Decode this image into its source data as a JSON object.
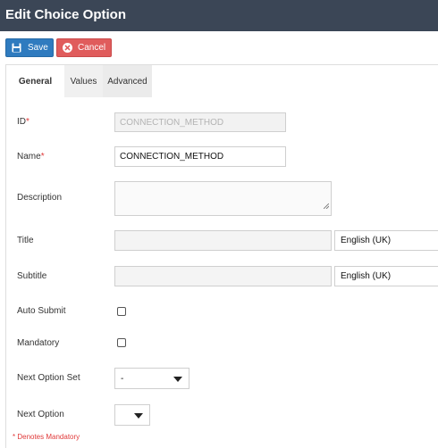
{
  "window": {
    "title": "Edit Choice Option"
  },
  "toolbar": {
    "save_label": "Save",
    "cancel_label": "Cancel"
  },
  "tabs": [
    {
      "label": "General",
      "active": true
    },
    {
      "label": "Values",
      "active": false
    },
    {
      "label": "Advanced",
      "active": false
    }
  ],
  "form": {
    "id": {
      "label": "ID",
      "required_mark": "*",
      "value": "CONNECTION_METHOD",
      "disabled": true
    },
    "name": {
      "label": "Name",
      "required_mark": "*",
      "value": "CONNECTION_METHOD"
    },
    "description": {
      "label": "Description",
      "value": ""
    },
    "title": {
      "label": "Title",
      "value": "",
      "language": "English (UK)"
    },
    "subtitle": {
      "label": "Subtitle",
      "value": "",
      "language": "English (UK)"
    },
    "auto_submit": {
      "label": "Auto Submit",
      "checked": false
    },
    "mandatory": {
      "label": "Mandatory",
      "checked": false
    },
    "next_option_set": {
      "label": "Next Option Set",
      "value": "-"
    },
    "next_option": {
      "label": "Next Option",
      "value": ""
    }
  },
  "footnote": "* Denotes Mandatory",
  "icons": {
    "save": "floppy-disk-icon",
    "cancel": "cancel-circle-icon",
    "dropdown": "caret-down-icon",
    "resize": "resize-grip-icon"
  },
  "colors": {
    "titlebar": "#3b4656",
    "save": "#2f7bbf",
    "cancel": "#e05c5c",
    "required": "#e03a3a"
  }
}
